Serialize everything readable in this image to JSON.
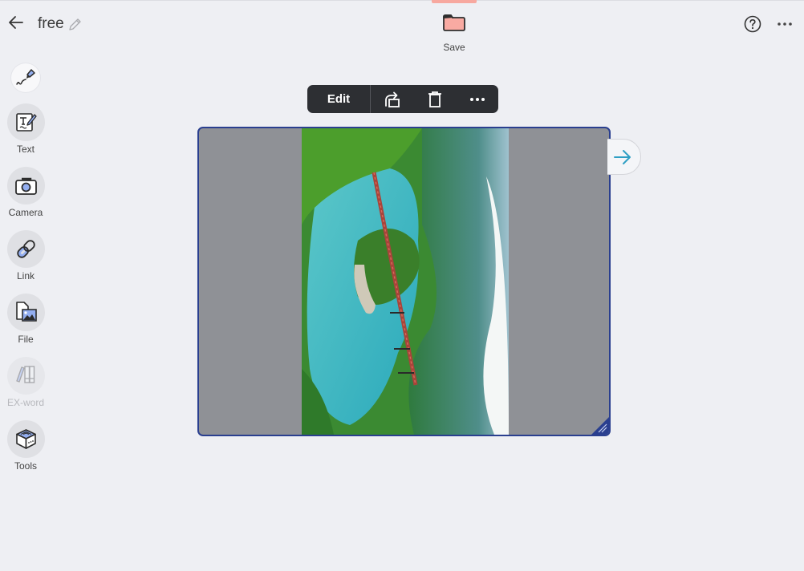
{
  "header": {
    "title": "free",
    "save_label": "Save",
    "icons": {
      "back": "arrow-left-icon",
      "rename": "pencil-icon",
      "save": "folder-icon",
      "help": "question-circle-icon",
      "more": "more-horizontal-icon"
    }
  },
  "sidebar": {
    "items": [
      {
        "id": "pen",
        "label": "",
        "icon": "pen-icon",
        "enabled": true
      },
      {
        "id": "text",
        "label": "Text",
        "icon": "text-edit-icon",
        "enabled": true
      },
      {
        "id": "camera",
        "label": "Camera",
        "icon": "camera-icon",
        "enabled": true
      },
      {
        "id": "link",
        "label": "Link",
        "icon": "link-icon",
        "enabled": true
      },
      {
        "id": "file",
        "label": "File",
        "icon": "file-image-icon",
        "enabled": true
      },
      {
        "id": "exword",
        "label": "EX-word",
        "icon": "books-icon",
        "enabled": false
      },
      {
        "id": "tools",
        "label": "Tools",
        "icon": "toolbox-icon",
        "enabled": true
      }
    ]
  },
  "context_toolbar": {
    "edit_label": "Edit",
    "icons": [
      "rotate-icon",
      "trash-icon",
      "more-horizontal-icon"
    ]
  },
  "canvas": {
    "card_content": "photo of turquoise lake with red truss bridge and forested island (rotated)",
    "next_icon": "arrow-right-icon"
  },
  "colors": {
    "background": "#eeeff3",
    "save_accent": "#f7a89f",
    "selection_border": "#2a3f8f",
    "toolbar_bg": "#2d2f33",
    "next_arrow": "#2f9fc4"
  }
}
